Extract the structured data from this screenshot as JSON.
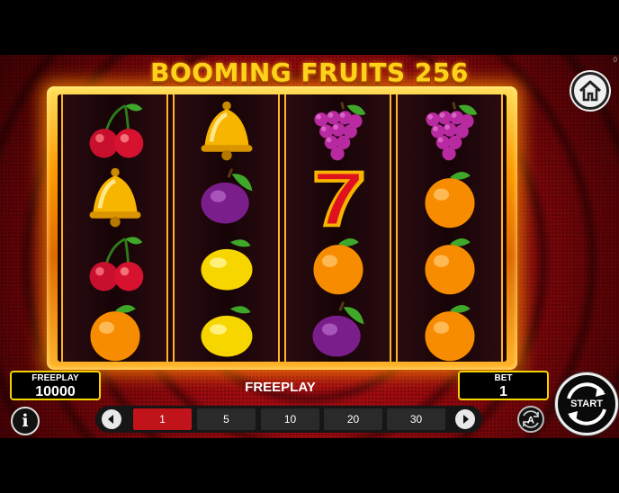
{
  "game": {
    "title": "BOOMING FRUITS 256",
    "corner_mark": "0"
  },
  "icons": {
    "home": "home-icon",
    "info": "info-icon",
    "prev": "left-arrow-icon",
    "next": "right-arrow-icon",
    "auto": "autoplay-icon",
    "start": "spin-arrows-icon"
  },
  "reels": [
    [
      "cherry",
      "bell",
      "cherry",
      "orange"
    ],
    [
      "bell",
      "plum",
      "lemon",
      "lemon"
    ],
    [
      "grapes",
      "seven",
      "orange",
      "plum"
    ],
    [
      "grapes",
      "orange",
      "orange",
      "orange"
    ]
  ],
  "balance": {
    "label": "FREEPLAY",
    "value": "10000"
  },
  "status": "FREEPLAY",
  "bet": {
    "label": "BET",
    "value": "1"
  },
  "bet_options": {
    "selected": "1",
    "items": [
      "1",
      "5",
      "10",
      "20",
      "30"
    ]
  },
  "info_label": "i",
  "auto_label": "A",
  "start_label": "START",
  "colors": {
    "accent": "#f5d400",
    "selected": "#c0141a",
    "background": "#9a0a0f"
  }
}
